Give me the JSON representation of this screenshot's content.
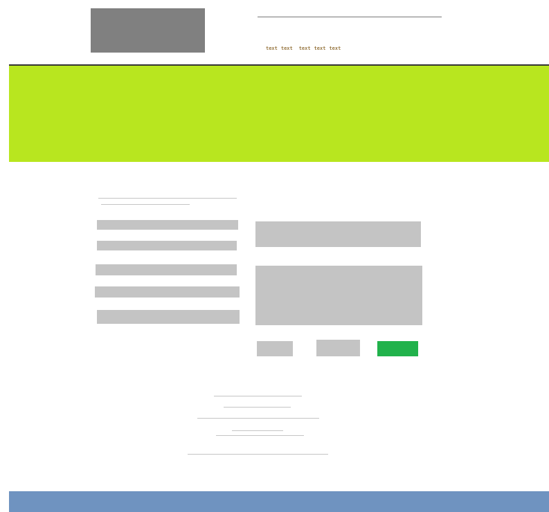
{
  "colors": {
    "hero": "#b8e61f",
    "footer": "#6f93c0",
    "submit": "#21b24b",
    "placeholder": "#c4c4c4",
    "logo": "#808080",
    "nav_text": "#9a7a46"
  },
  "header": {
    "nav": [
      "text",
      "text",
      "text",
      "text",
      "text"
    ]
  }
}
